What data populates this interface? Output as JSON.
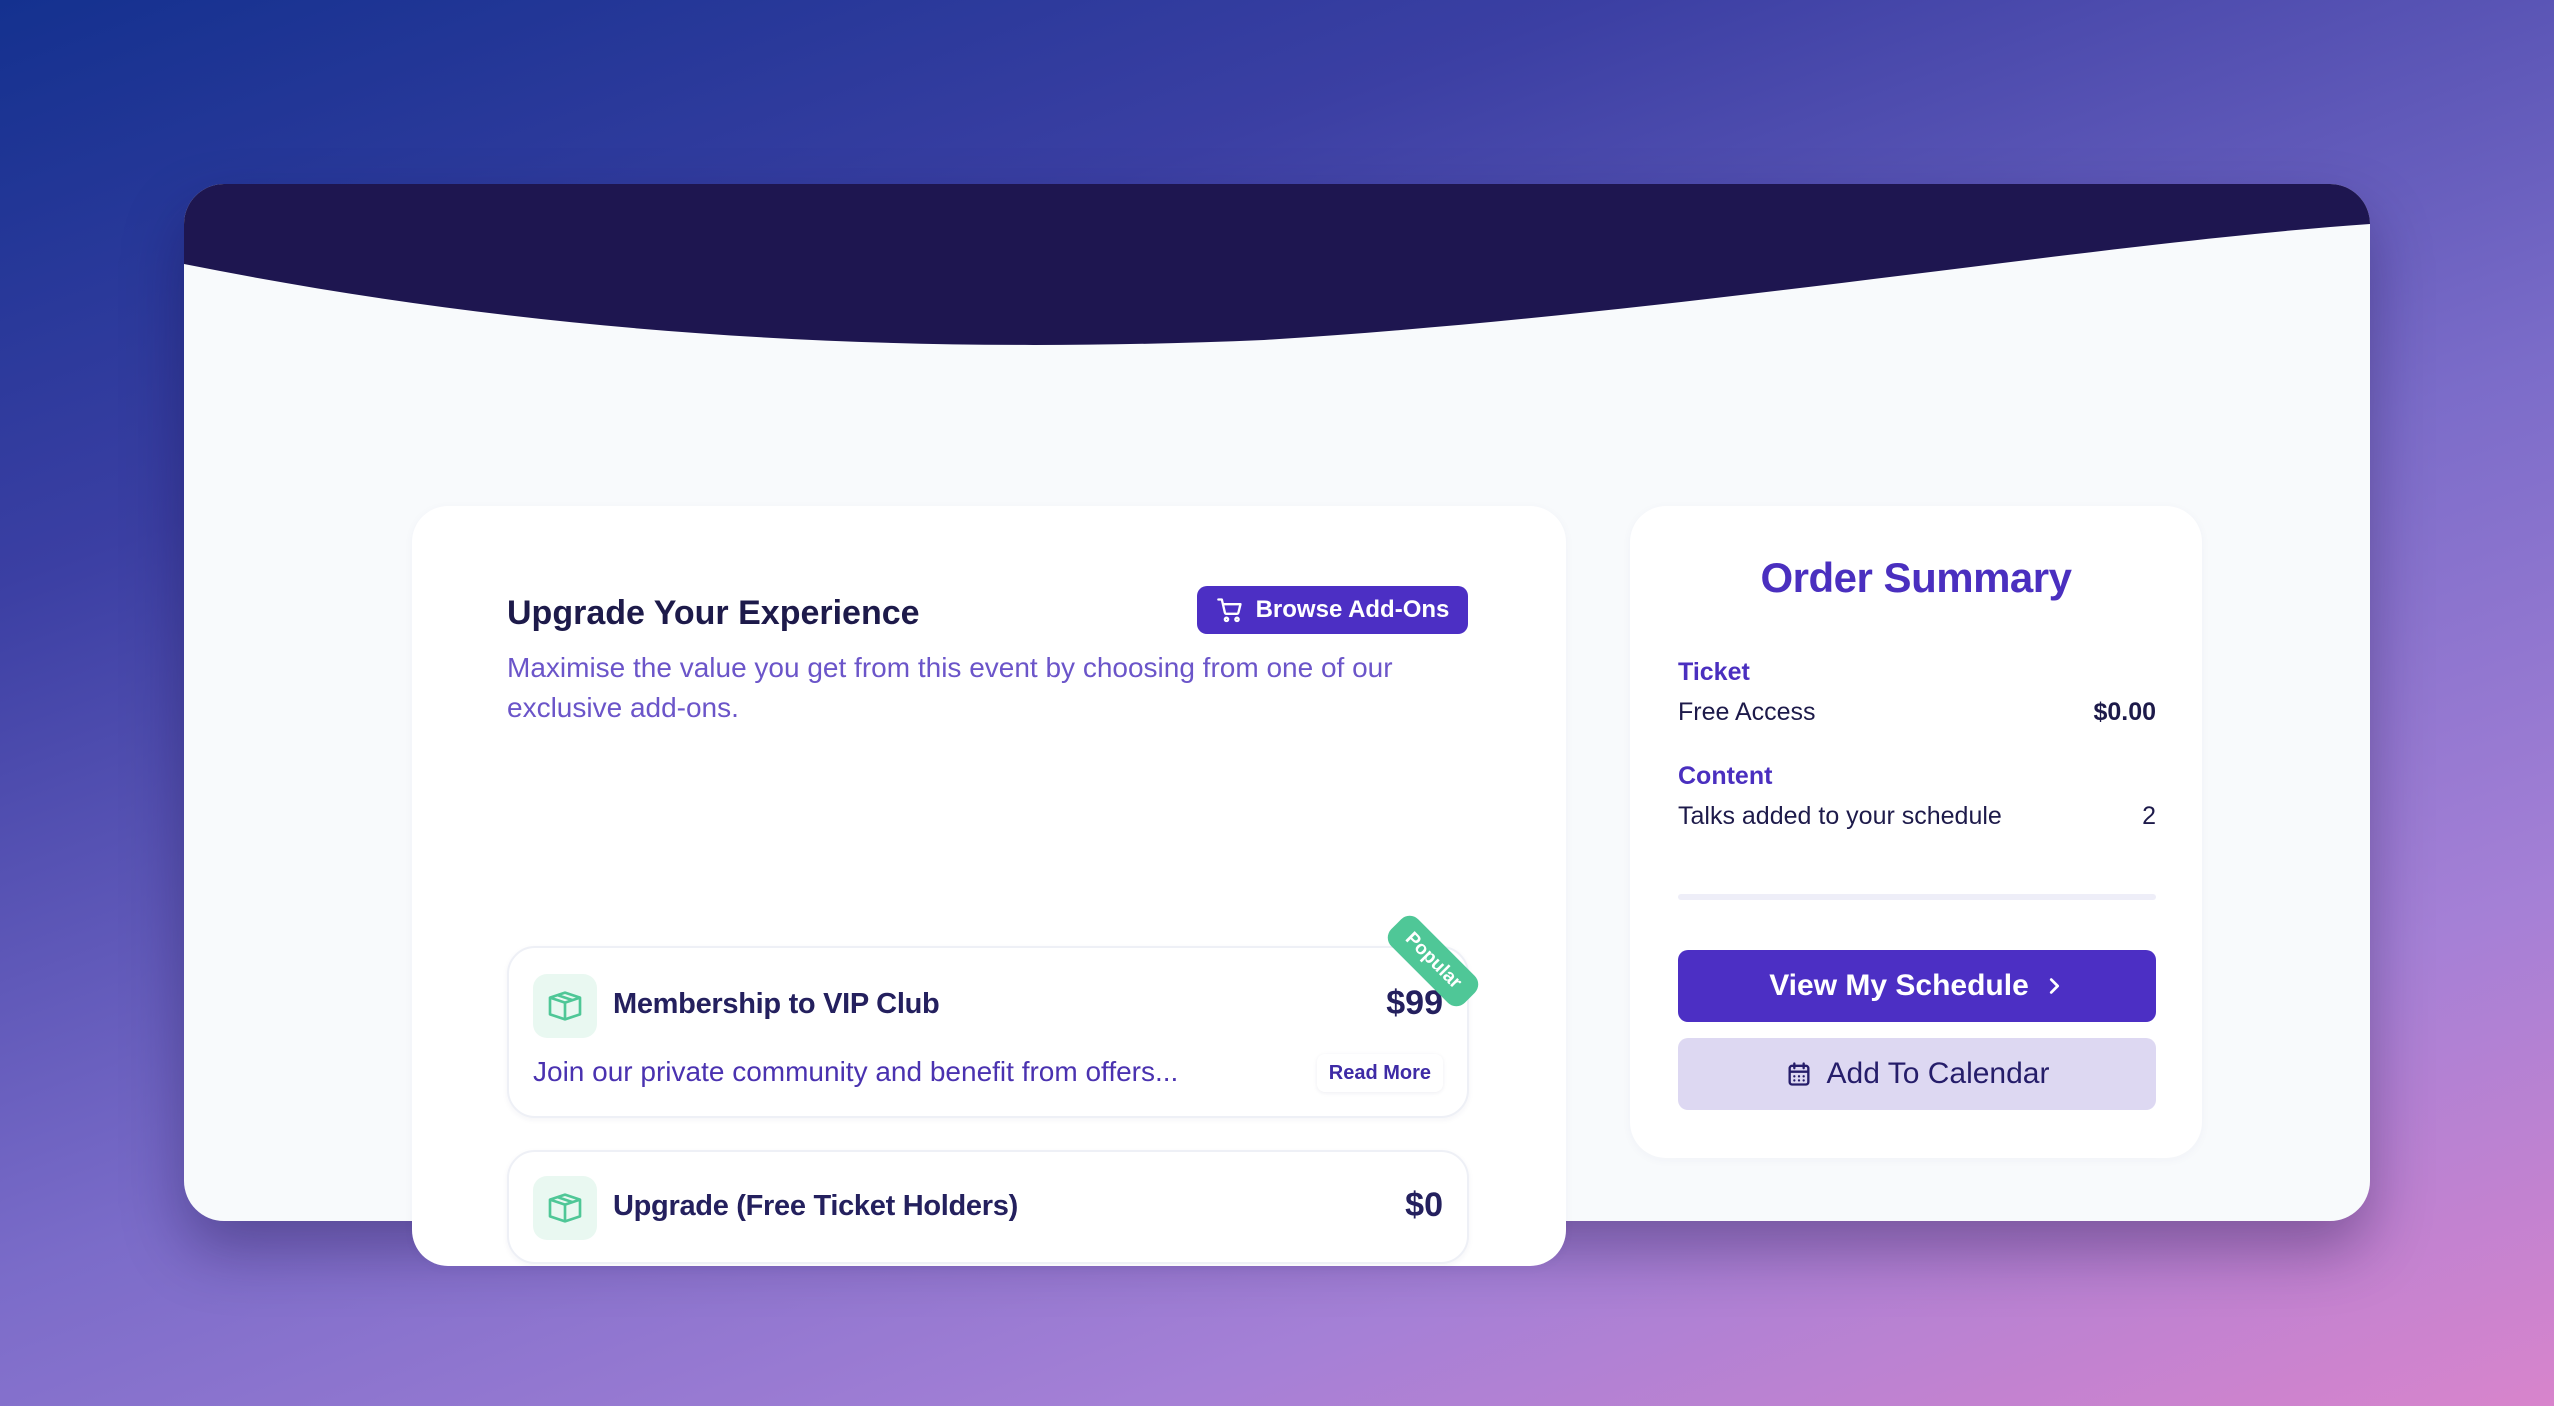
{
  "colors": {
    "header_wave": "#1e1650",
    "primary": "#4c2fc4",
    "accent_green": "#4fc797",
    "secondary_button": "#ddd8f2"
  },
  "upgrade": {
    "title": "Upgrade Your Experience",
    "browse_label": "Browse Add-Ons",
    "browse_icon": "cart-icon",
    "description": "Maximise the value you get from this event by choosing from one of our exclusive add-ons.",
    "addons": [
      {
        "name": "Membership to VIP Club",
        "price": "$99",
        "badge": "Popular",
        "description": "Join our private community and benefit from offers...",
        "read_more": "Read More",
        "icon": "box-icon"
      },
      {
        "name": "Upgrade (Free Ticket Holders)",
        "price": "$0",
        "icon": "box-icon"
      }
    ]
  },
  "summary": {
    "title": "Order Summary",
    "ticket_label": "Ticket",
    "ticket_name": "Free Access",
    "ticket_price": "$0.00",
    "content_label": "Content",
    "content_name": "Talks added to your schedule",
    "content_count": "2",
    "view_schedule_label": "View My Schedule",
    "view_schedule_icon": "chevron-right-icon",
    "add_calendar_label": "Add To Calendar",
    "add_calendar_icon": "calendar-icon"
  }
}
